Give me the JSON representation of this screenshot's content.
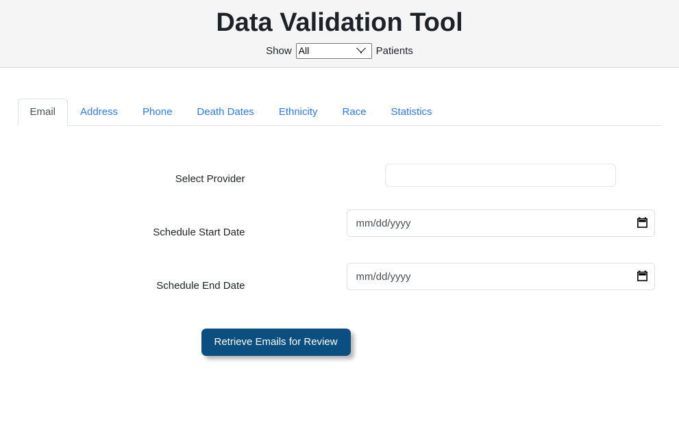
{
  "header": {
    "title": "Data Validation Tool",
    "show_prefix": "Show",
    "show_suffix": "Patients",
    "patient_filter": {
      "selected": "All",
      "options": [
        "All"
      ]
    }
  },
  "tabs": [
    {
      "label": "Email",
      "active": true
    },
    {
      "label": "Address",
      "active": false
    },
    {
      "label": "Phone",
      "active": false
    },
    {
      "label": "Death Dates",
      "active": false
    },
    {
      "label": "Ethnicity",
      "active": false
    },
    {
      "label": "Race",
      "active": false
    },
    {
      "label": "Statistics",
      "active": false
    }
  ],
  "form": {
    "provider": {
      "label": "Select Provider",
      "value": "",
      "placeholder": ""
    },
    "start_date": {
      "label": "Schedule Start Date",
      "value": "",
      "placeholder": "mm/dd/yyyy",
      "icon": "calendar-icon"
    },
    "end_date": {
      "label": "Schedule End Date",
      "value": "",
      "placeholder": "mm/dd/yyyy",
      "icon": "calendar-icon"
    },
    "submit_label": "Retrieve Emails for Review"
  },
  "colors": {
    "header_bg": "#f5f5f5",
    "tab_link": "#2b7bfb",
    "tab_active_text": "#495057",
    "button_bg": "#0b4f80",
    "title_text": "#1d2228",
    "border": "#dee2e6"
  }
}
